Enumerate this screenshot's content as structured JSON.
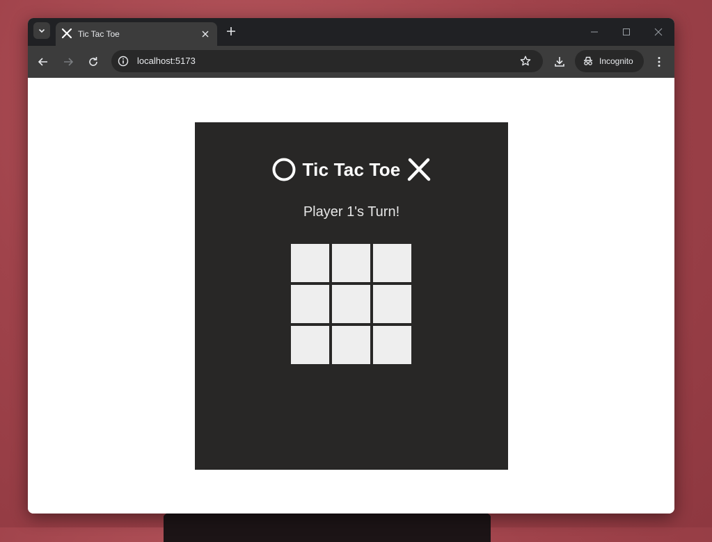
{
  "browser": {
    "tab_title": "Tic Tac Toe",
    "url": "localhost:5173",
    "incognito_label": "Incognito",
    "icons": {
      "tab_search": "chevron-down-icon",
      "favicon": "x-icon",
      "tab_close": "close-icon",
      "new_tab": "plus-icon",
      "minimize": "minimize-icon",
      "maximize": "maximize-icon",
      "close_window": "close-icon",
      "back": "arrow-left-icon",
      "forward": "arrow-right-icon",
      "reload": "reload-icon",
      "site_info": "info-icon",
      "bookmark": "star-icon",
      "downloads": "download-icon",
      "incognito": "incognito-icon",
      "menu": "more-vertical-icon"
    }
  },
  "game": {
    "title": "Tic Tac Toe",
    "status": "Player 1's Turn!",
    "board": [
      "",
      "",
      "",
      "",
      "",
      "",
      "",
      "",
      ""
    ]
  },
  "colors": {
    "game_background": "#282726",
    "cell": "#eeeeee",
    "desktop": "#a0434b"
  }
}
